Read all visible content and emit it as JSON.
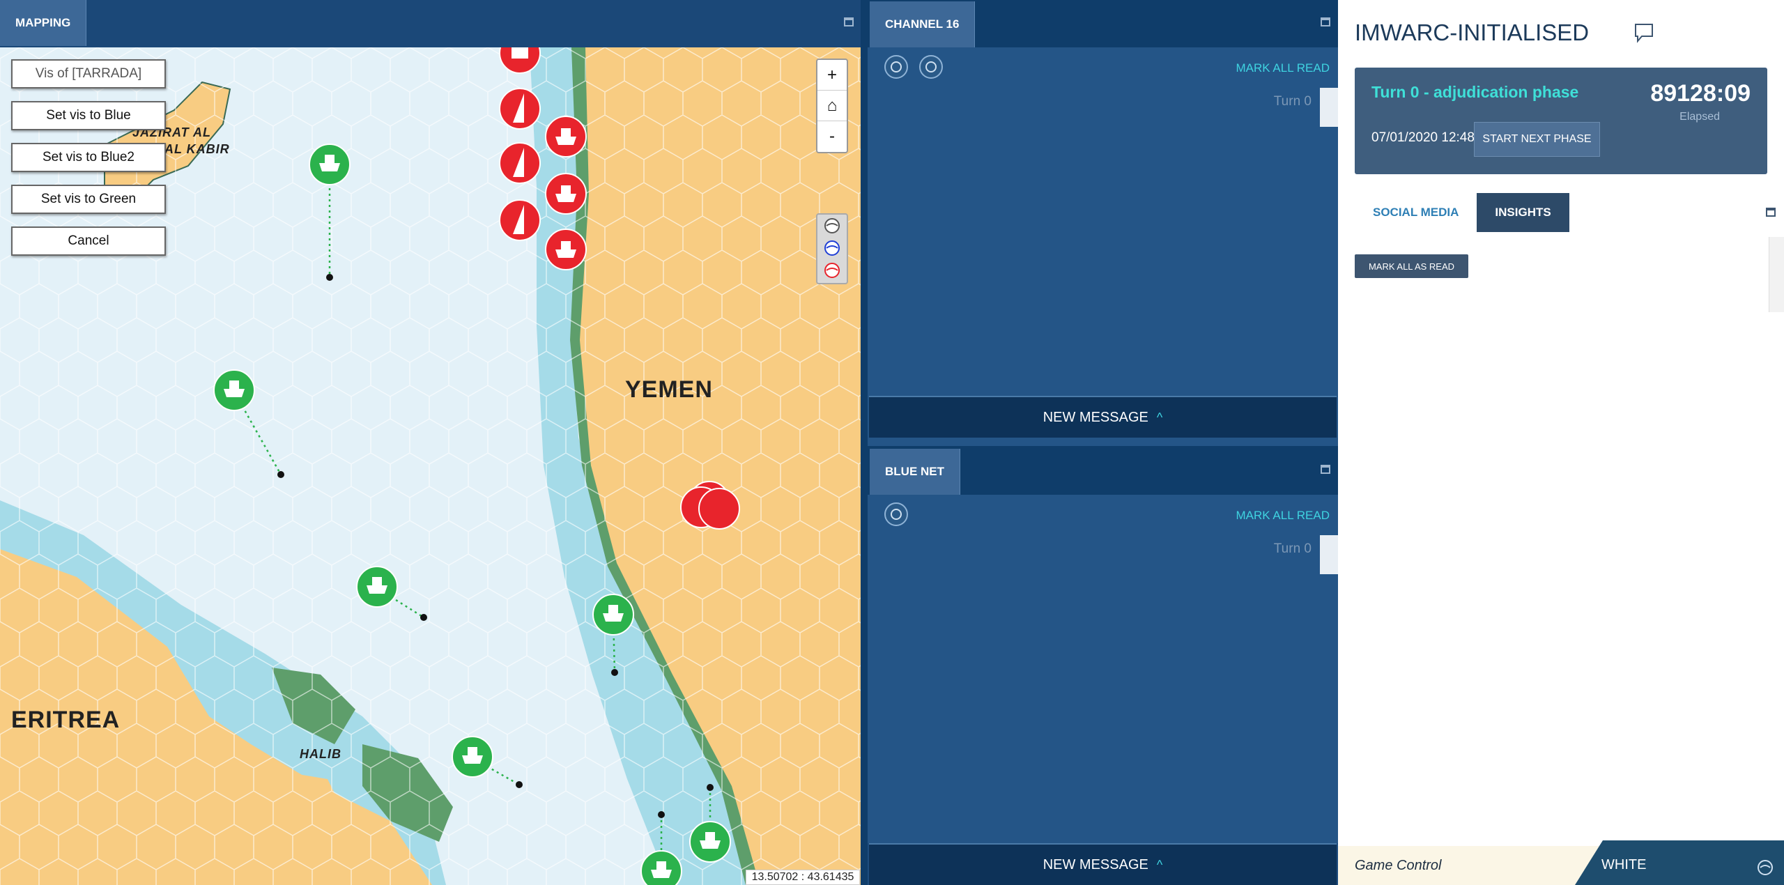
{
  "map": {
    "tab": "MAPPING",
    "vis_buttons": [
      "Vis of [TARRADA]",
      "Set vis to Blue",
      "Set vis to Blue2",
      "Set vis to Green",
      "Cancel"
    ],
    "zoom": {
      "in": "+",
      "home": "⌂",
      "out": "-"
    },
    "places": {
      "yemen": "YEMEN",
      "eritrea": "ERITREA",
      "jazirat": "JAZIRAT AL",
      "kabir": "AL KABIR",
      "halib": "HALIB"
    },
    "coords": "13.50702 : 43.61435",
    "colors": {
      "sea": "#e3f1f8",
      "shallow": "#a5dbe8",
      "land": "#f8cc82",
      "green_force": "#2bb24c",
      "red_force": "#e8242c",
      "reef": "#5e9e6b"
    }
  },
  "channel16": {
    "tab": "CHANNEL 16",
    "mark_all_read": "MARK ALL READ",
    "turn": "Turn 0",
    "new_message": "NEW MESSAGE",
    "caret": "^"
  },
  "bluenet": {
    "tab": "BLUE NET",
    "mark_all_read": "MARK ALL READ",
    "turn": "Turn 0",
    "new_message": "NEW MESSAGE",
    "caret": "^"
  },
  "game": {
    "title": "IMWARC-INITIALISED",
    "phase": "Turn 0 - adjudication phase",
    "timer": "89128:09",
    "elapsed_label": "Elapsed",
    "date": "07/01/2020 12:48",
    "start_next_phase": "START NEXT PHASE",
    "tabs": [
      "SOCIAL MEDIA",
      "INSIGHTS"
    ],
    "mark_all_as_read": "MARK ALL AS READ"
  },
  "footer": {
    "left": "Game Control",
    "right": "WHITE"
  }
}
